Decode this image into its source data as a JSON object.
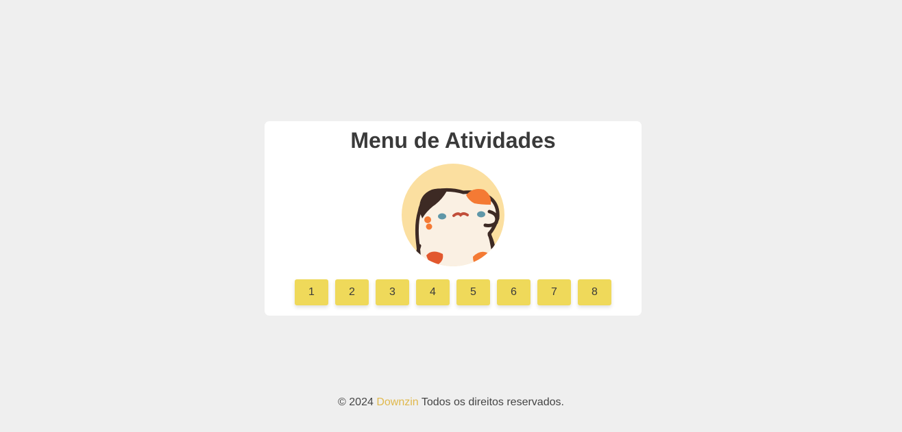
{
  "card": {
    "title": "Menu de Atividades",
    "avatar_icon": "hamster-avatar-icon",
    "buttons": [
      "1",
      "2",
      "3",
      "4",
      "5",
      "6",
      "7",
      "8"
    ]
  },
  "footer": {
    "prefix": "© 2024",
    "brand": "Downzin",
    "suffix": "Todos os direitos reservados."
  },
  "colors": {
    "background": "#efefef",
    "card": "#ffffff",
    "button": "#efd95a",
    "brand_link": "#e0b84c",
    "avatar_bg": "#fbdfa0"
  }
}
